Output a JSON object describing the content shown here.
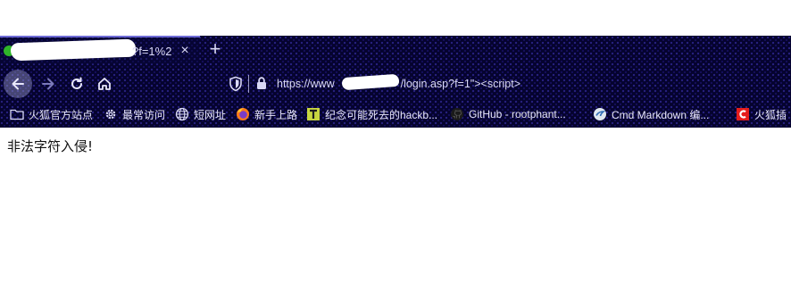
{
  "tab": {
    "title_visible": "?f=1%2",
    "close_glyph": "×",
    "new_tab_glyph": "+"
  },
  "address_bar": {
    "url_prefix": "https://www",
    "url_suffix": "/login.asp?f=1\"><script>"
  },
  "bookmarks": [
    {
      "label": "火狐官方站点",
      "icon": "folder-icon"
    },
    {
      "label": "最常访问",
      "icon": "gear-icon"
    },
    {
      "label": "短网址",
      "icon": "globe-icon"
    },
    {
      "label": "新手上路",
      "icon": "firefox-icon"
    },
    {
      "label": "纪念可能死去的hackb...",
      "icon": "t-logo-icon"
    },
    {
      "label": "GitHub - rootphant...",
      "icon": "github-icon"
    },
    {
      "label": "Cmd Markdown 编...",
      "icon": "cmd-markdown-icon"
    },
    {
      "label": "火狐插",
      "icon": "c-logo-icon"
    }
  ],
  "page": {
    "message": "非法字符入侵!"
  },
  "colors": {
    "chrome_bg": "#05032e",
    "chrome_text": "#d9d8f5",
    "tab_accent": "#6e6bd6",
    "page_bg": "#ffffff"
  }
}
